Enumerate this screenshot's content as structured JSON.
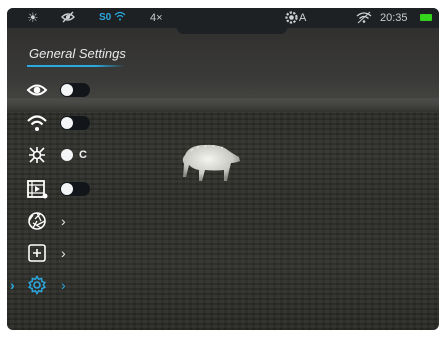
{
  "status_bar": {
    "icons": [
      "sun-brightness-icon",
      "eye-off-icon",
      "wifi-icon",
      "palette-icon",
      "battery-icon"
    ],
    "mode_label": "S0",
    "zoom": "4×",
    "palette_label": "A",
    "time": "20:35"
  },
  "menu": {
    "title": "General Settings",
    "items": [
      {
        "icon": "eye-icon",
        "control": "toggle",
        "state": "on"
      },
      {
        "icon": "wifi-icon",
        "control": "toggle",
        "state": "on"
      },
      {
        "icon": "calibration-icon",
        "control": "toggle",
        "state": "on",
        "suffix": "C"
      },
      {
        "icon": "video-record-icon",
        "control": "toggle",
        "state": "on"
      },
      {
        "icon": "aperture-icon",
        "control": "submenu",
        "chevron": "›"
      },
      {
        "icon": "plus-square-icon",
        "control": "submenu",
        "chevron": "›"
      },
      {
        "icon": "gear-icon",
        "control": "submenu",
        "chevron": "›",
        "selected": true,
        "selection_marker": "›"
      }
    ]
  },
  "colors": {
    "accent": "#2aa8e0",
    "battery": "#34d31c",
    "status_bar_bg": "#1e2124",
    "text": "#e8eaec"
  }
}
